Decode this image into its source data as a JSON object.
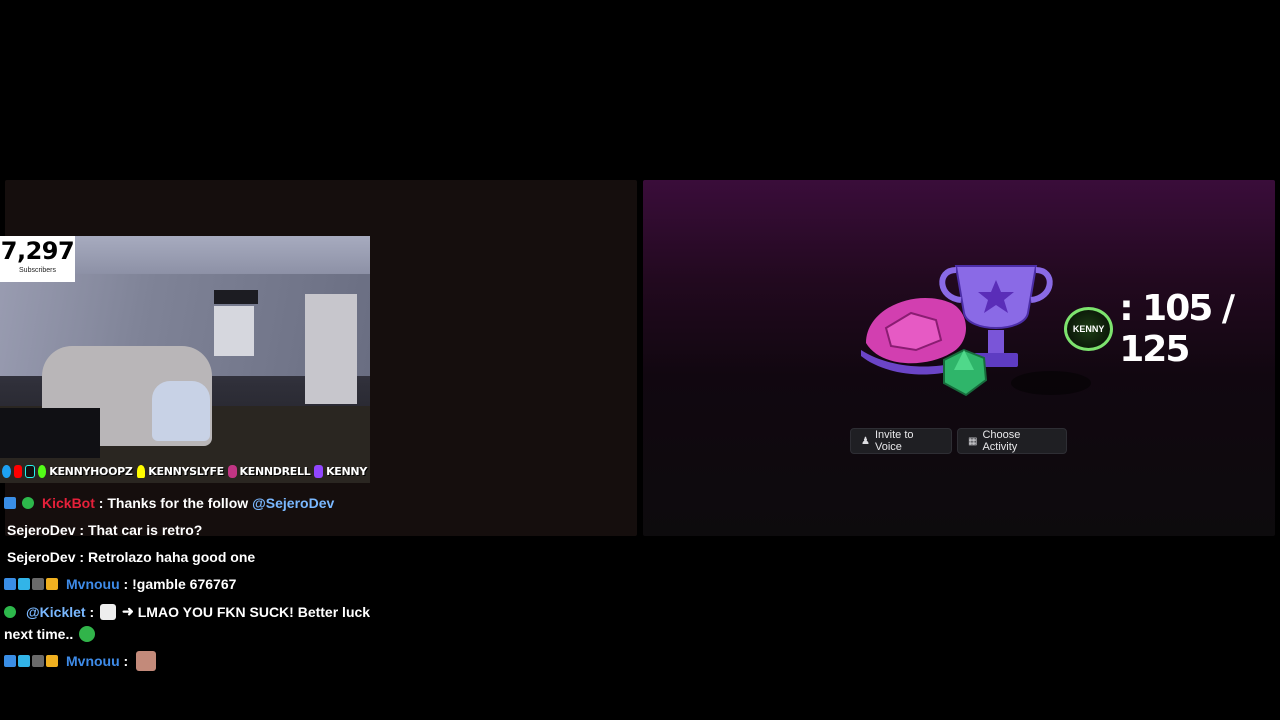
{
  "subscribers": {
    "count": "7,297",
    "label": "Subscribers"
  },
  "social": {
    "handles": [
      "KENNYHOOPZ",
      "KENNYSLYFE",
      "KENNDRELL",
      "KENNY"
    ]
  },
  "chat": {
    "messages": [
      {
        "user": "KickBot",
        "sep": " : ",
        "text": "Thanks for the follow",
        "mention": "@SejeroDev"
      },
      {
        "user": "SejeroDev",
        "sep": " : ",
        "text": "That car is retro?"
      },
      {
        "user": "SejeroDev",
        "sep": " : ",
        "text": "Retrolazo haha good one"
      },
      {
        "user": "Mvnouu",
        "sep": " : ",
        "text": "!gamble 676767"
      },
      {
        "user": "@Kicklet",
        "sep": " : ",
        "arrow": "➜",
        "text": "LMAO YOU FKN SUCK! Better luck",
        "text2": "next time.."
      },
      {
        "user": "Mvnouu",
        "sep": " : "
      }
    ]
  },
  "activity": {
    "counter": ": 105 / 125",
    "logo_text": "KENNY",
    "invite_label": "Invite to Voice",
    "choose_label": "Choose Activity"
  },
  "colors": {
    "kickbot": "#e6203a",
    "username_blue": "#3e8be8",
    "mention": "#7ab8ff",
    "kick_green": "#53fc18"
  }
}
